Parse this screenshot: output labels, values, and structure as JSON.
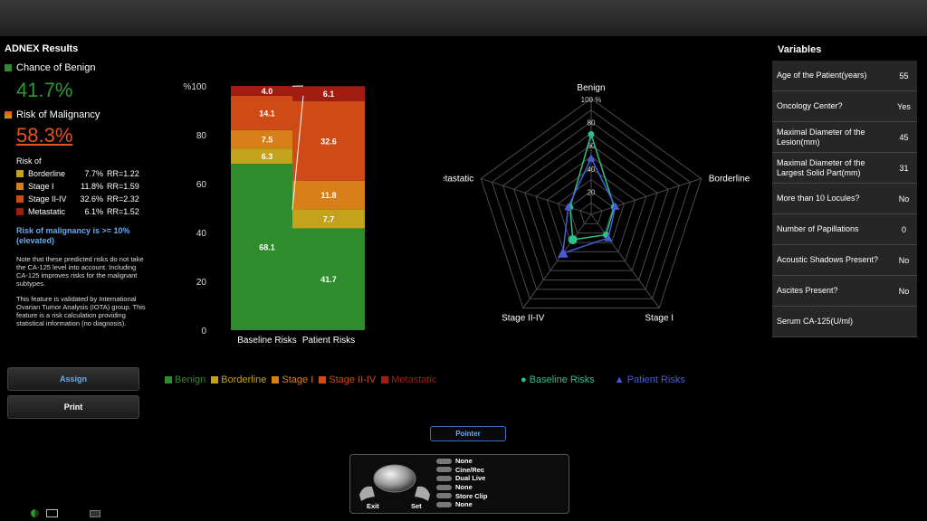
{
  "app": {
    "title": "ADNEX Results"
  },
  "summary": {
    "benign_label": "Chance of Benign",
    "benign_value": "41.7%",
    "malignancy_label": "Risk of Malignancy",
    "malignancy_value": "58.3%",
    "risk_of_label": "Risk of",
    "risks": [
      {
        "name": "Borderline",
        "pct": "7.7%",
        "rr": "RR=1.22",
        "color": "#c4a21c"
      },
      {
        "name": "Stage I",
        "pct": "11.8%",
        "rr": "RR=1.59",
        "color": "#d7801a"
      },
      {
        "name": "Stage II-IV",
        "pct": "32.6%",
        "rr": "RR=2.32",
        "color": "#cf4a16"
      },
      {
        "name": "Metastatic",
        "pct": "6.1%",
        "rr": "RR=1.52",
        "color": "#a11d12"
      }
    ],
    "warning": "Risk of malignancy is >= 10% (elevated)",
    "note1": "Note that these predicted risks do not take the CA-125 level into account. Including CA-125 improves risks for the malignant subtypes.",
    "note2": "This feature is validated by International Ovarian Tumor Analysis (IOTA) group. This feature is a risk calculation providing statistical information (no diagnosis)."
  },
  "buttons": {
    "assign": "Assign",
    "print": "Print",
    "pointer": "Pointer"
  },
  "variables": {
    "title": "Variables",
    "rows": [
      {
        "label": "Age of the Patient(years)",
        "value": "55"
      },
      {
        "label": "Oncology Center?",
        "value": "Yes"
      },
      {
        "label": "Maximal Diameter of the Lesion(mm)",
        "value": "45"
      },
      {
        "label": "Maximal Diameter of the Largest Solid Part(mm)",
        "value": "31"
      },
      {
        "label": "More than 10 Locules?",
        "value": "No"
      },
      {
        "label": "Number of Papillations",
        "value": "0"
      },
      {
        "label": "Acoustic Shadows Present?",
        "value": "No"
      },
      {
        "label": "Ascites Present?",
        "value": "No"
      },
      {
        "label": "Serum CA-125(U/ml)",
        "value": ""
      }
    ]
  },
  "colors": {
    "benign": "#2e8b2e",
    "borderline": "#c4a21c",
    "stage1": "#d7801a",
    "stage2": "#cf4a16",
    "metastatic": "#a11d12",
    "baseline": "#2fc08a",
    "patient": "#4a5bd6"
  },
  "chart_data": [
    {
      "type": "bar",
      "stacked": true,
      "categories": [
        "Baseline Risks",
        "Patient Risks"
      ],
      "yticks": [
        "0",
        "20",
        "40",
        "60",
        "80",
        "%100"
      ],
      "ylim": [
        0,
        100
      ],
      "series": [
        {
          "name": "Benign",
          "values": [
            68.1,
            41.7
          ],
          "labels": [
            "68.1",
            "41.7"
          ],
          "color": "#2e8b2e"
        },
        {
          "name": "Borderline",
          "values": [
            6.3,
            7.7
          ],
          "labels": [
            "6.3",
            "7.7"
          ],
          "color": "#c4a21c"
        },
        {
          "name": "Stage I",
          "values": [
            7.5,
            11.8
          ],
          "labels": [
            "7.5",
            "11.8"
          ],
          "color": "#d7801a"
        },
        {
          "name": "Stage II-IV",
          "values": [
            14.1,
            32.6
          ],
          "labels": [
            "14.1",
            "32.6"
          ],
          "color": "#cf4a16"
        },
        {
          "name": "Metastatic",
          "values": [
            4.0,
            6.1
          ],
          "labels": [
            "4.0",
            "6.1"
          ],
          "color": "#a11d12"
        }
      ]
    },
    {
      "type": "radar",
      "axes": [
        "Benign",
        "Borderline",
        "Stage I",
        "Stage II-IV",
        "Metastatic"
      ],
      "rlim": [
        0,
        100
      ],
      "ring_labels": [
        "20",
        "40",
        "60",
        "80",
        "100 %"
      ],
      "series": [
        {
          "name": "Baseline Risks",
          "values": [
            68.1,
            6.3,
            7.5,
            14.1,
            4.0
          ],
          "marker": "circle",
          "color": "#2fc08a"
        },
        {
          "name": "Patient Risks",
          "values": [
            41.7,
            7.7,
            11.8,
            32.6,
            6.1
          ],
          "marker": "triangle",
          "color": "#4a5bd6"
        }
      ]
    }
  ],
  "control_panel": {
    "exit": "Exit",
    "set": "Set",
    "items": [
      "None",
      "Cine/Rec",
      "Dual Live",
      "None",
      "Store Clip",
      "None"
    ]
  }
}
